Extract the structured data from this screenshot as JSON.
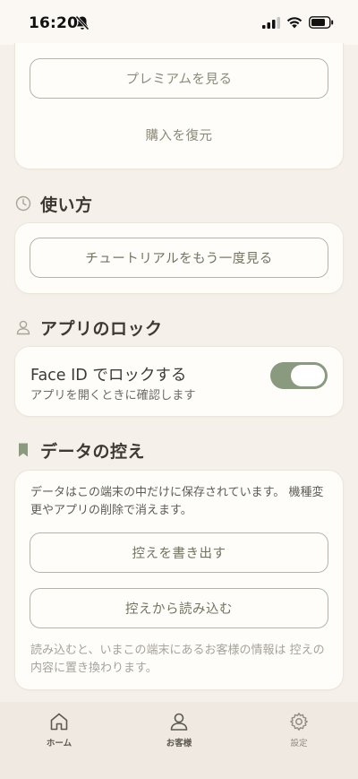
{
  "status_bar": {
    "time": "16:20"
  },
  "premium_card": {
    "view_premium_label": "プレミアムを見る",
    "restore_label": "購入を復元"
  },
  "usage": {
    "title": "使い方",
    "tutorial_label": "チュートリアルをもう一度見る"
  },
  "app_lock": {
    "title": "アプリのロック",
    "face_id_label": "Face ID でロックする",
    "face_id_sub": "アプリを開くときに確認します",
    "face_id_enabled": true
  },
  "backup": {
    "title": "データの控え",
    "description": "データはこの端末の中だけに保存されています。 機種変更やアプリの削除で消えます。",
    "export_label": "控えを書き出す",
    "import_label": "控えから読み込む",
    "note": "読み込むと、いまこの端末にあるお客様の情報は 控えの内容に置き換わります。"
  },
  "tab_bar": {
    "home": "ホーム",
    "customers": "お客様",
    "settings": "設定"
  },
  "colors": {
    "background": "#f5f0e9",
    "card": "#fffdfa",
    "accent": "#8a9a7e",
    "tab_bar": "#efe9e1"
  }
}
